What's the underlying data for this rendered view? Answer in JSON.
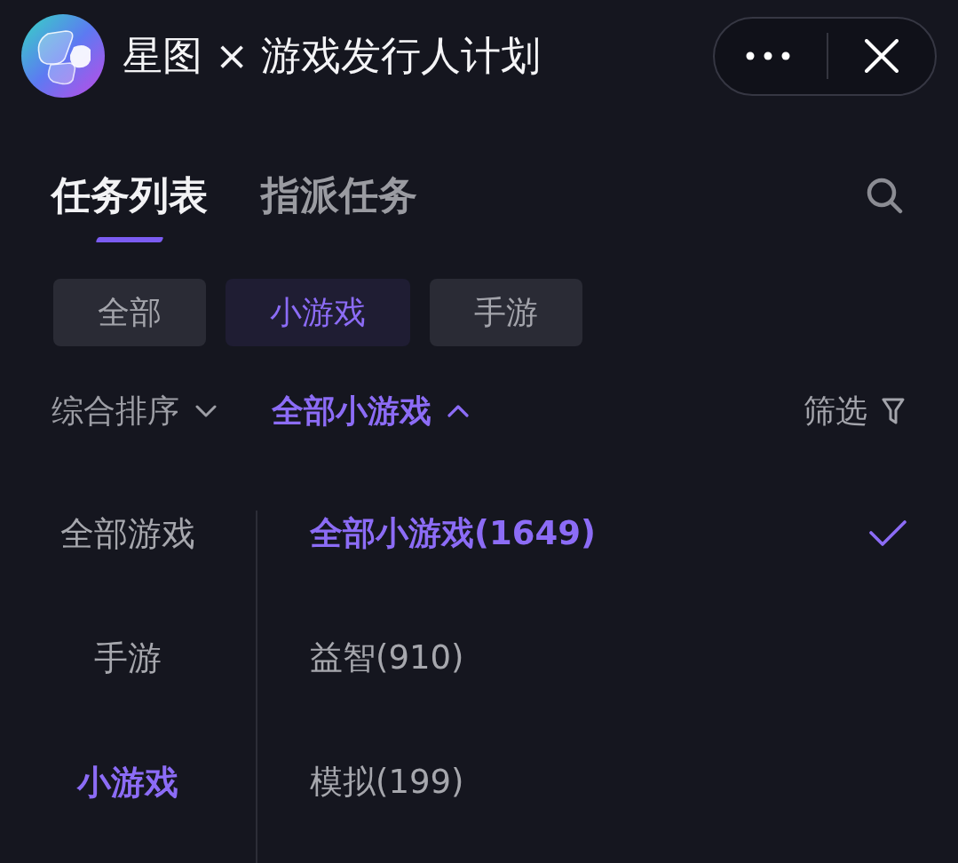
{
  "header": {
    "title": "星图 × 游戏发行人计划"
  },
  "tabs": [
    {
      "label": "任务列表",
      "selected": true
    },
    {
      "label": "指派任务",
      "selected": false
    }
  ],
  "chips": [
    {
      "label": "全部",
      "selected": false
    },
    {
      "label": "小游戏",
      "selected": true
    },
    {
      "label": "手游",
      "selected": false
    }
  ],
  "sort_bar": {
    "dropdowns": [
      {
        "label": "综合排序",
        "expanded": false
      },
      {
        "label": "全部小游戏",
        "expanded": true
      }
    ],
    "filter": {
      "label": "筛选"
    }
  },
  "dropdown": {
    "groups": [
      {
        "label": "全部游戏",
        "selected": false
      },
      {
        "label": "手游",
        "selected": false
      },
      {
        "label": "小游戏",
        "selected": true
      }
    ],
    "options": [
      {
        "label": "全部小游戏(1649)",
        "selected": true
      },
      {
        "label": "益智(910)",
        "selected": false
      },
      {
        "label": "模拟(199)",
        "selected": false
      }
    ]
  }
}
